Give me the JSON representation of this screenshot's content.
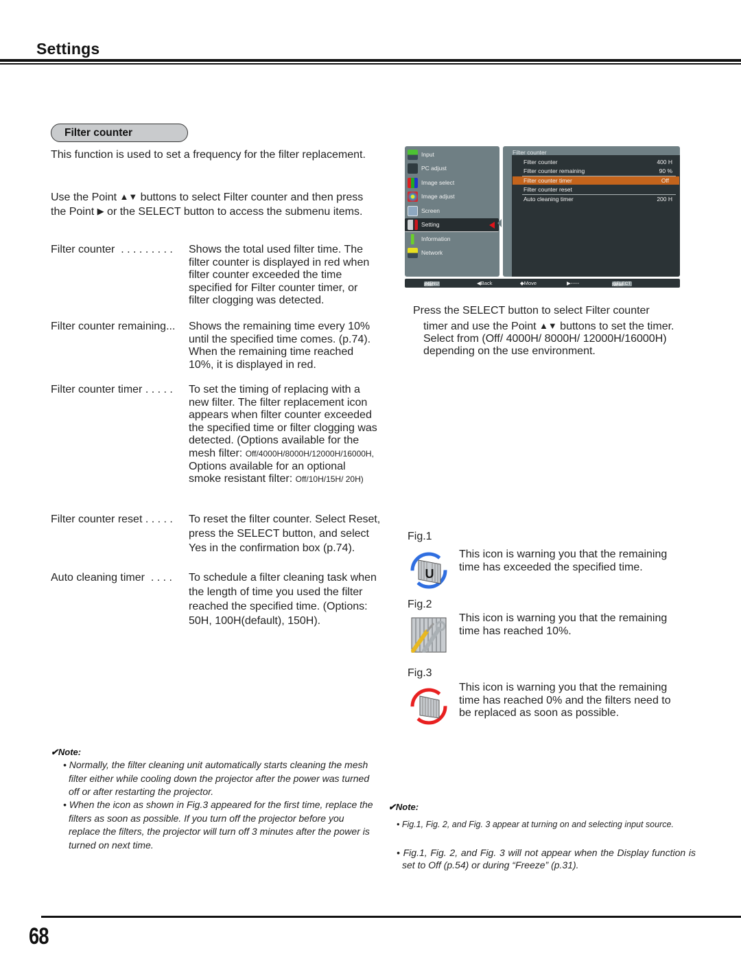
{
  "header": {
    "title": "Settings"
  },
  "section": {
    "title": "Filter counter"
  },
  "intro": {
    "p1": "This function is used to set a frequency for the filter replacement.",
    "p2_a": "Use the Point ",
    "p2_arrows": "▲▼",
    "p2_b": " buttons to select Filter counter and then press the Point ",
    "p2_right": "▶",
    "p2_c": " or the SELECT button to access the submenu items."
  },
  "definitions": [
    {
      "term": "Filter counter  . . . . . . . . .",
      "desc": "Shows the total used filter time. The filter counter is displayed in red when filter counter exceeded the time specified for Filter counter timer, or filter clogging was detected."
    },
    {
      "term": "Filter counter remaining...",
      "desc": "Shows the remaining time every 10% until the specified time comes. (p.74). When the remaining time reached 10%, it is displayed in red."
    },
    {
      "term": "Filter counter timer . . . . .",
      "desc_a": "To set the timing of replacing with a new filter. The filter replacement icon appears when filter counter exceeded the specified time or filter clogging was detected. (Options available for the mesh filter: ",
      "desc_opt1": "Off/4000H/8000H/12000H/16000H,",
      "desc_b": " Options available for an optional smoke resistant filter: ",
      "desc_opt2": "Off/10H/15H/ 20H)"
    },
    {
      "term": "Filter counter reset . . . . .",
      "desc": "To reset the filter counter. Select Reset, press the SELECT button, and select Yes in the confirmation box (p.74)."
    },
    {
      "term": "Auto cleaning timer  . . . .",
      "desc": "To schedule a filter cleaning task when the length of time you used the filter reached the specified time. (Options: 50H, 100H(default), 150H)."
    }
  ],
  "osd": {
    "menu": [
      {
        "label": "Input",
        "icon": "input-icon"
      },
      {
        "label": "PC adjust",
        "icon": "pc-adjust-icon"
      },
      {
        "label": "Image select",
        "icon": "image-select-icon"
      },
      {
        "label": "Image adjust",
        "icon": "image-adjust-icon"
      },
      {
        "label": "Screen",
        "icon": "screen-icon"
      },
      {
        "label": "Setting",
        "icon": "setting-icon",
        "active": true
      },
      {
        "label": "Information",
        "icon": "information-icon"
      },
      {
        "label": "Network",
        "icon": "network-icon"
      }
    ],
    "submenu_title": "Filter counter",
    "submenu": [
      {
        "label": "Filter counter",
        "value": "400 H"
      },
      {
        "label": "Filter counter remaining",
        "value": "90 %"
      },
      {
        "label": "Filter counter timer",
        "value": "Off",
        "highlighted": true
      },
      {
        "label": "Filter counter reset",
        "value": ""
      },
      {
        "label": "Auto cleaning timer",
        "value": "200 H"
      }
    ],
    "footer": {
      "menu_key": "MENU",
      "exit": "Exit",
      "back": "◀Back",
      "move": "◆Move",
      "next_arrow": "▶-----",
      "select_key": "SELECT",
      "next": "Next"
    },
    "colors": {
      "panel": "#6f7f84",
      "dark": "#2b3336",
      "highlight": "#c4641c",
      "selector": "#e0141a"
    }
  },
  "right_para": {
    "line1": "Press the SELECT button to select Filter counter",
    "line2_a": "timer and use the Point ",
    "line2_arrows": "▲▼",
    "line2_b": " buttons to set the timer. Select from (Off/ 4000H/ 8000H/ 12000H/16000H) depending on the use environment."
  },
  "figures": [
    {
      "label": "Fig.1",
      "text": "This icon is warning you that the remaining time has exceeded the specified time.",
      "icon": "filter-exceeded-icon"
    },
    {
      "label": "Fig.2",
      "text": "This icon is warning you that the remaining time has reached 10%.",
      "icon": "filter-maintenance-icon"
    },
    {
      "label": "Fig.3",
      "text": "This icon is warning you that the remaining time has reached 0% and the filters need to be replaced as soon as possible.",
      "icon": "filter-replace-icon"
    }
  ],
  "notes_left": {
    "heading": "✔Note:",
    "items": [
      "• Normally, the filter cleaning unit automatically starts cleaning the mesh filter either while cooling down the projector after the power was turned off or after restarting the projector.",
      "• When the icon as shown in Fig.3 appeared for the first time, replace the filters as soon as possible. If you turn off the projector before you replace the filters, the projector will turn off 3 minutes after the power is turned on next time."
    ]
  },
  "notes_right": {
    "heading": "✔Note:",
    "items": [
      "• Fig.1, Fig. 2, and Fig. 3 appear at turning on and selecting input source.",
      "• Fig.1, Fig. 2, and Fig. 3 will not appear when the Display function is set to Off (p.54) or during “Freeze” (p.31)."
    ]
  },
  "footer": {
    "page_number": "68"
  }
}
